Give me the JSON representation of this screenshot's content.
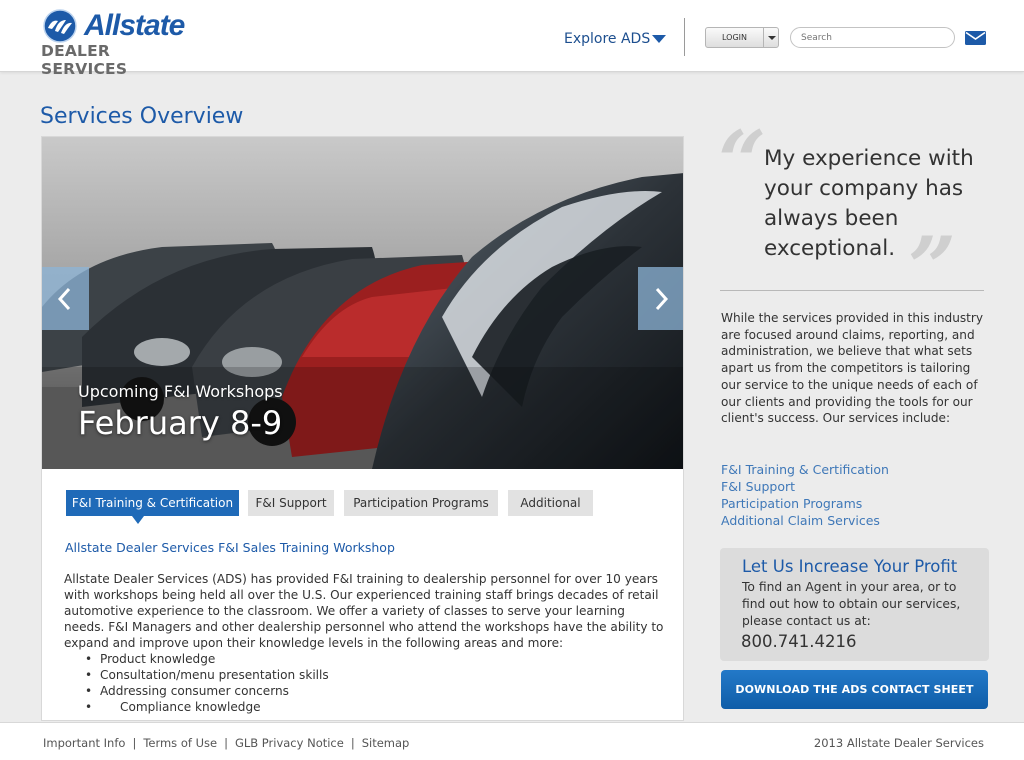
{
  "header": {
    "logo_word": "Allstate",
    "logo_sub": "DEALER SERVICES",
    "explore_label": "Explore ADS",
    "login_label": "LOGIN",
    "search_placeholder": "Search"
  },
  "page_title": "Services Overview",
  "hero": {
    "subtitle": "Upcoming F&I Workshops",
    "title": "February 8-9"
  },
  "tabs": [
    {
      "label": "F&I Training & Certification",
      "active": true
    },
    {
      "label": "F&I Support",
      "active": false
    },
    {
      "label": "Participation Programs",
      "active": false
    },
    {
      "label": "Additional",
      "active": false
    }
  ],
  "tab_content": {
    "heading": "Allstate Dealer Services F&I Sales Training Workshop",
    "body": "Allstate Dealer Services (ADS) has provided F&I training to dealership personnel for over 10 years with workshops being held all over the U.S. Our experienced training staff brings decades of retail automotive experience to the classroom. We offer a variety of classes to serve your learning needs. F&I Managers and other dealership personnel who attend the workshops have the ability to expand and improve upon their knowledge levels in the following areas and more:",
    "bullets": [
      "Product knowledge",
      "Consultation/menu presentation skills",
      "Addressing consumer concerns",
      "Compliance knowledge"
    ]
  },
  "sidebar": {
    "quote": "My experience with your company has always been exceptional.",
    "intro": "While the services provided in this industry are focused around claims, reporting, and administration, we believe that what sets apart us from the competitors is tailoring our service to the unique needs of each of our clients and providing the tools for our client's success. Our services include:",
    "links": [
      "F&I Training & Certification",
      "F&I Support",
      "Participation Programs",
      "Additional Claim Services"
    ],
    "profit": {
      "title": "Let Us Increase Your Profit",
      "text": "To find an Agent in your area, or to find out how to obtain our services, please contact us at:",
      "phone": "800.741.4216"
    },
    "download_label": "DOWNLOAD THE ADS CONTACT SHEET"
  },
  "footer": {
    "links": [
      "Important Info",
      "Terms of Use",
      "GLB Privacy Notice",
      "Sitemap"
    ],
    "copyright": "2013 Allstate Dealer Services"
  },
  "colors": {
    "brand_blue": "#1d5aa8",
    "active_tab": "#1f6ab8",
    "link_blue": "#3f78b8",
    "background": "#ececec"
  },
  "icons": [
    "allstate-hands-logo-icon",
    "chevron-down-icon",
    "mail-icon",
    "chevron-left-icon",
    "chevron-right-icon"
  ]
}
